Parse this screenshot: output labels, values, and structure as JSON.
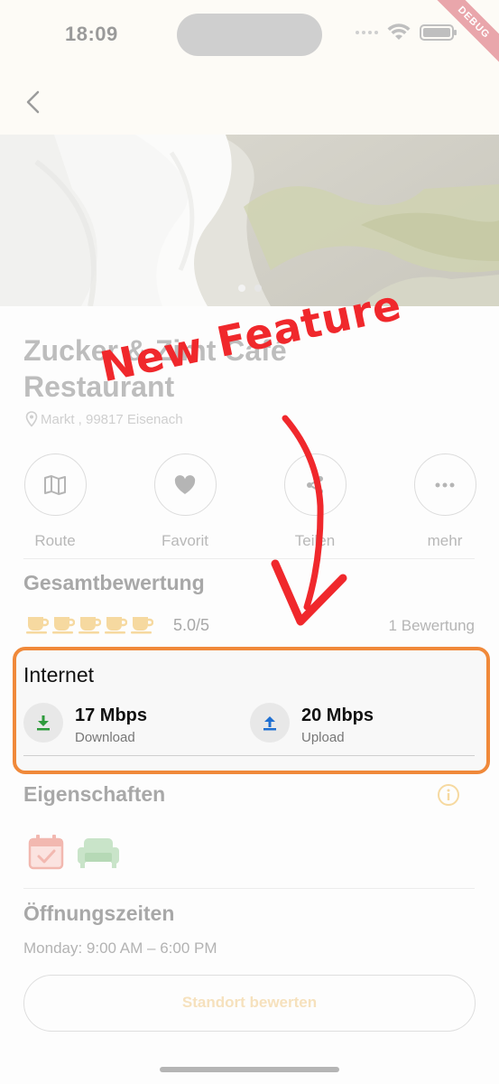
{
  "status_bar": {
    "time": "18:09",
    "debug_label": "DEBUG",
    "icons": [
      "signal-dots-icon",
      "wifi-icon",
      "battery-icon"
    ]
  },
  "nav": {
    "back_icon": "chevron-left-icon"
  },
  "gallery": {
    "pages": 2,
    "active_page": 1
  },
  "place": {
    "title": "Zucker & Zimt Café Restaurant",
    "address": "Markt , 99817 Eisenach"
  },
  "actions": [
    {
      "label": "Route",
      "icon": "map-icon"
    },
    {
      "label": "Favorit",
      "icon": "heart-icon"
    },
    {
      "label": "Teilen",
      "icon": "share-icon"
    },
    {
      "label": "mehr",
      "icon": "more-icon"
    }
  ],
  "rating": {
    "heading": "Gesamtbewertung",
    "score": "5.0/5",
    "reviews": "1 Bewertung",
    "cups_filled": 5,
    "cups_total": 5
  },
  "internet": {
    "heading": "Internet",
    "download": {
      "value": "17 Mbps",
      "label": "Download",
      "icon": "download-icon"
    },
    "upload": {
      "value": "20 Mbps",
      "label": "Upload",
      "icon": "upload-icon"
    }
  },
  "features": {
    "heading": "Eigenschaften",
    "items": [
      "calendar-check-icon",
      "sofa-icon"
    ]
  },
  "hours": {
    "heading": "Öffnungszeiten",
    "text": "Monday: 9:00 AM – 6:00 PM"
  },
  "cta": {
    "label": "Standort bewerten"
  },
  "annotation": {
    "text": "New Feature"
  },
  "colors": {
    "highlight_border": "#f0893a",
    "annotation_red": "#f0282c",
    "download_green": "#2e9a3c",
    "upload_blue": "#1f6fd1",
    "cup_yellow": "#f6d9a0"
  }
}
